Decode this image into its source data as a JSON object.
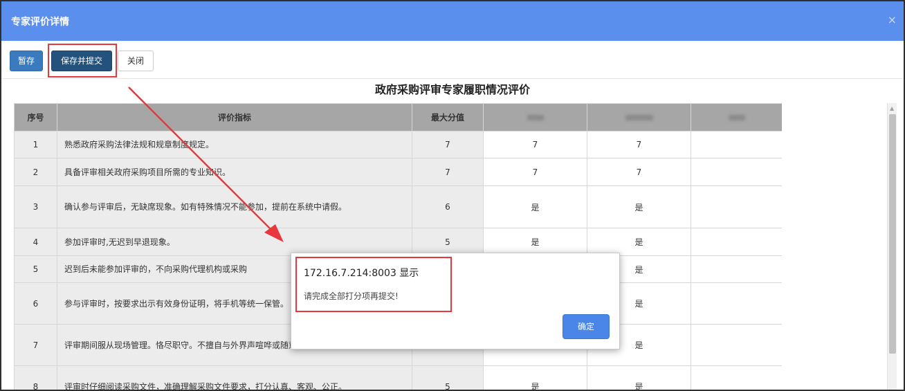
{
  "dialog_window": {
    "title": "专家评价详情",
    "close_glyph": "×"
  },
  "toolbar": {
    "save_label": "暂存",
    "submit_label": "保存并提交",
    "close_label": "关闭"
  },
  "page_heading": "政府采购评审专家履职情况评价",
  "table": {
    "headers": {
      "seq": "序号",
      "indicator": "评价指标",
      "max_score": "最大分值"
    },
    "blurred_expert_headers": 3,
    "rows": [
      {
        "seq": "1",
        "indicator": "熟悉政府采购法律法规和规章制度规定。",
        "max": "7",
        "s1": "7",
        "s2": "7",
        "s3": ""
      },
      {
        "seq": "2",
        "indicator": "具备评审相关政府采购项目所需的专业知识。",
        "max": "7",
        "s1": "7",
        "s2": "7",
        "s3": ""
      },
      {
        "seq": "3",
        "indicator": "确认参与评审后，无缺席现象。如有特殊情况不能参加，提前在系统中请假。",
        "max": "6",
        "s1": "是",
        "s2": "是",
        "s3": ""
      },
      {
        "seq": "4",
        "indicator": "参加评审时,无迟到早退现象。",
        "max": "5",
        "s1": "是",
        "s2": "是",
        "s3": ""
      },
      {
        "seq": "5",
        "indicator": "迟到后未能参加评审的，不向采购代理机构或采购",
        "max": "",
        "s1": "",
        "s2": "是",
        "s3": ""
      },
      {
        "seq": "6",
        "indicator": "参与评审时，按要求出示有效身份证明，将手机等统一保管。",
        "max": "",
        "s1": "",
        "s2": "是",
        "s3": ""
      },
      {
        "seq": "7",
        "indicator": "评审期间服从现场管理。恪尽职守。不擅自与外界声喧哗或随意走动，遵守现场纪律。",
        "max": "",
        "s1": "",
        "s2": "是",
        "s3": ""
      },
      {
        "seq": "8",
        "indicator": "评审时仔细阅读采购文件，准确理解采购文件要求，打分认真、客观、公正。",
        "max": "5",
        "s1": "是",
        "s2": "是",
        "s3": ""
      }
    ]
  },
  "alert": {
    "title": "172.16.7.214:8003 显示",
    "message": "请完成全部打分项再提交!",
    "ok_label": "确定"
  },
  "colors": {
    "titlebar": "#5b8fee",
    "header_row": "#a6a6a6",
    "highlight": "#e8383d",
    "ok_button": "#4a86e8"
  }
}
